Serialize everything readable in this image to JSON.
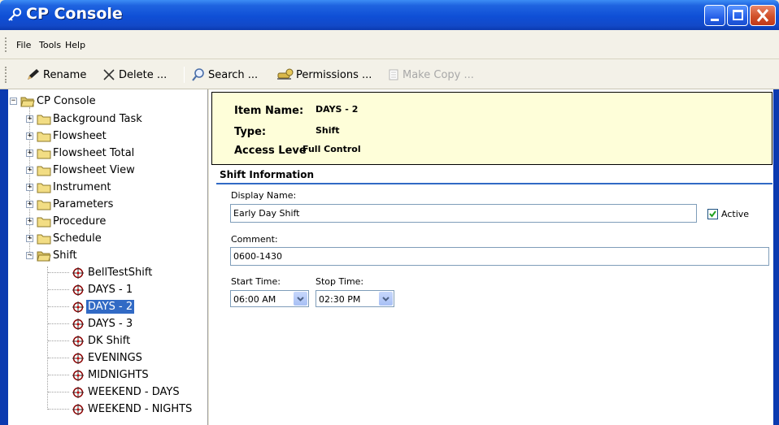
{
  "window": {
    "title": "CP Console",
    "icon": "key-icon",
    "colors": {
      "titlebar": "#0f4fd6",
      "close": "#d1502a",
      "selection": "#316ac5",
      "info_bg": "#fefed9"
    }
  },
  "menu": {
    "items": [
      "File",
      "Tools",
      "Help"
    ]
  },
  "toolbar": {
    "rename": "Rename",
    "delete": "Delete ...",
    "search": "Search ...",
    "permissions": "Permissions ...",
    "make_copy": "Make Copy ..."
  },
  "tree": {
    "root": "CP Console",
    "folders": [
      "Background Task",
      "Flowsheet",
      "Flowsheet Total",
      "Flowsheet View",
      "Instrument",
      "Parameters",
      "Procedure",
      "Schedule",
      "Shift"
    ],
    "shift_items": [
      "BellTestShift",
      "DAYS - 1",
      "DAYS - 2",
      "DAYS - 3",
      "DK Shift",
      "EVENINGS",
      "MIDNIGHTS",
      "WEEKEND - DAYS",
      "WEEKEND - NIGHTS"
    ],
    "selected": "DAYS - 2"
  },
  "info": {
    "item_name_label": "Item Name:",
    "item_name_value": "DAYS - 2",
    "type_label": "Type:",
    "type_value": "Shift",
    "access_label": "Access Leve",
    "access_value": "Full Control"
  },
  "form": {
    "section_title": "Shift Information",
    "display_name_label": "Display Name:",
    "display_name_value": "Early Day Shift",
    "active_label": "Active",
    "active_checked": true,
    "comment_label": "Comment:",
    "comment_value": "0600-1430",
    "start_time_label": "Start Time:",
    "start_time_value": "06:00 AM",
    "stop_time_label": "Stop Time:",
    "stop_time_value": "02:30 PM"
  }
}
